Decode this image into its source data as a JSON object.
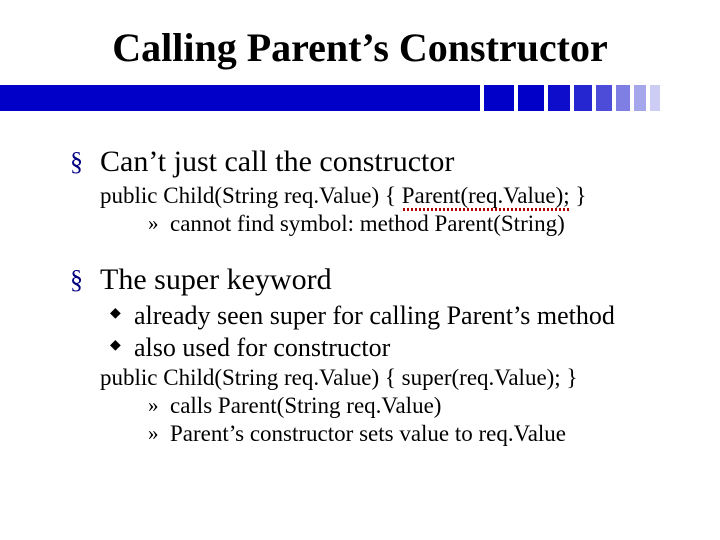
{
  "title": "Calling Parent’s Constructor",
  "s1": {
    "heading": "Can’t just call the constructor",
    "code_pre": "public Child(String req.Value) { ",
    "code_err": "Parent(req.Value);",
    "code_post": " }",
    "err": "cannot find symbol: method Parent(String)"
  },
  "s2": {
    "heading": "The super keyword",
    "p1": "already seen super for calling Parent’s method",
    "p2": "also used for constructor",
    "code": "public Child(String req.Value) { super(req.Value); }",
    "r1": "calls Parent(String req.Value)",
    "r2": "Parent’s constructor sets value to req.Value"
  }
}
